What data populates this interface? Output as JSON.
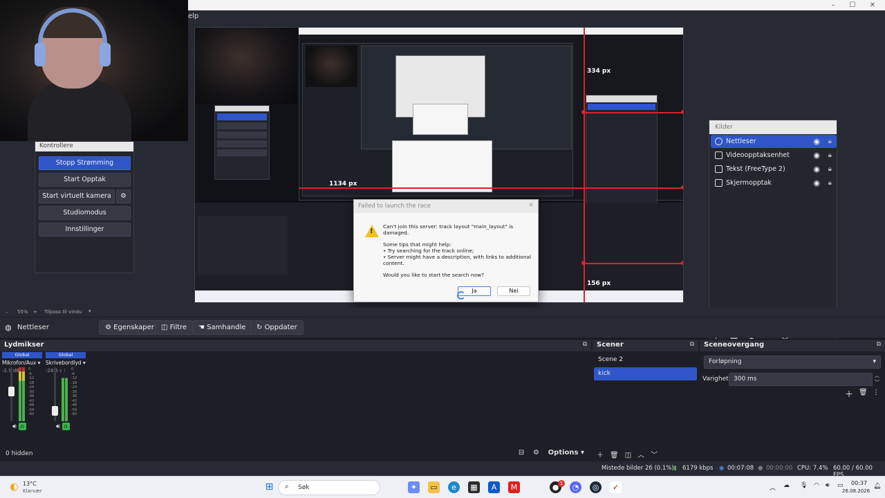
{
  "titlebar": {
    "menu_fragment": "elp",
    "min": "–",
    "max": "☐",
    "close": "✕"
  },
  "controls": {
    "title": "Kontrollere",
    "stop_streaming": "Stopp Strømming",
    "start_recording": "Start Opptak",
    "start_virtual_camera": "Start virtuelt kamera",
    "studio_mode": "Studiomodus",
    "settings": "Innstillinger"
  },
  "preview": {
    "label_334": "334 px",
    "label_1134": "1134 px",
    "label_156": "156 px"
  },
  "dialog": {
    "title": "Failed to launch the race",
    "line1": "Can't join this server: track layout \"main_layout\" is damaged.",
    "tips": "Some tips that might help:\n• Try searching for the track online;\n• Server might have a description, with links to additional content.",
    "question": "Would you like to start the search now?",
    "yes": "Ja",
    "no": "Nei"
  },
  "sources": {
    "title": "Kilder",
    "items": [
      {
        "label": "Nettleser",
        "icon": "globe-icon"
      },
      {
        "label": "Videoopptaksenhet",
        "icon": "camera-icon"
      },
      {
        "label": "Tekst (FreeType 2)",
        "icon": "text-icon"
      },
      {
        "label": "Skjermopptak",
        "icon": "monitor-icon"
      }
    ]
  },
  "zoombar": {
    "dash": "–",
    "zoom": "55%",
    "plus": "+",
    "fit": "Tilpass til vindu"
  },
  "source_toolbar": {
    "current": "Nettleser",
    "properties": "Egenskaper",
    "filters": "Filtre",
    "interact": "Samhandle",
    "refresh": "Oppdater"
  },
  "mixer": {
    "title": "Lydmikser",
    "channels": [
      {
        "badge": "Global",
        "name": "Mikrofon/Aux",
        "db": "-2.9 dB"
      },
      {
        "badge": "Global",
        "name": "Skrivebordlyd",
        "db": "-28.5 dB"
      }
    ],
    "ticks": "0\n-6\n-12\n-18\n-24\n-30\n-36\n-42\n-48\n-54\n-60",
    "hidden": "0 hidden",
    "options": "Options"
  },
  "scenes": {
    "title": "Scener",
    "items": [
      "Scene 2",
      "kick"
    ]
  },
  "transitions": {
    "title": "Sceneovergang",
    "type": "Forløpning",
    "duration_label": "Varighet",
    "duration": "300 ms"
  },
  "status": {
    "dropped": "Mistede bilder 26 (0.1%)",
    "bitrate": "6179 kbps",
    "stream_time": "00:07:08",
    "rec_time": "00:00:00",
    "cpu": "CPU: 7.4%",
    "fps": "60.00 / 60.00 FPS"
  },
  "taskbar": {
    "temp": "13°C",
    "weather": "Klarvær",
    "search": "Søk",
    "time": "00:37",
    "date": "26.08.2026",
    "badge": "1"
  },
  "colors": {
    "accent": "#2f55c8",
    "red_guides": "#d9232e",
    "meter_green": "#49b14b"
  }
}
